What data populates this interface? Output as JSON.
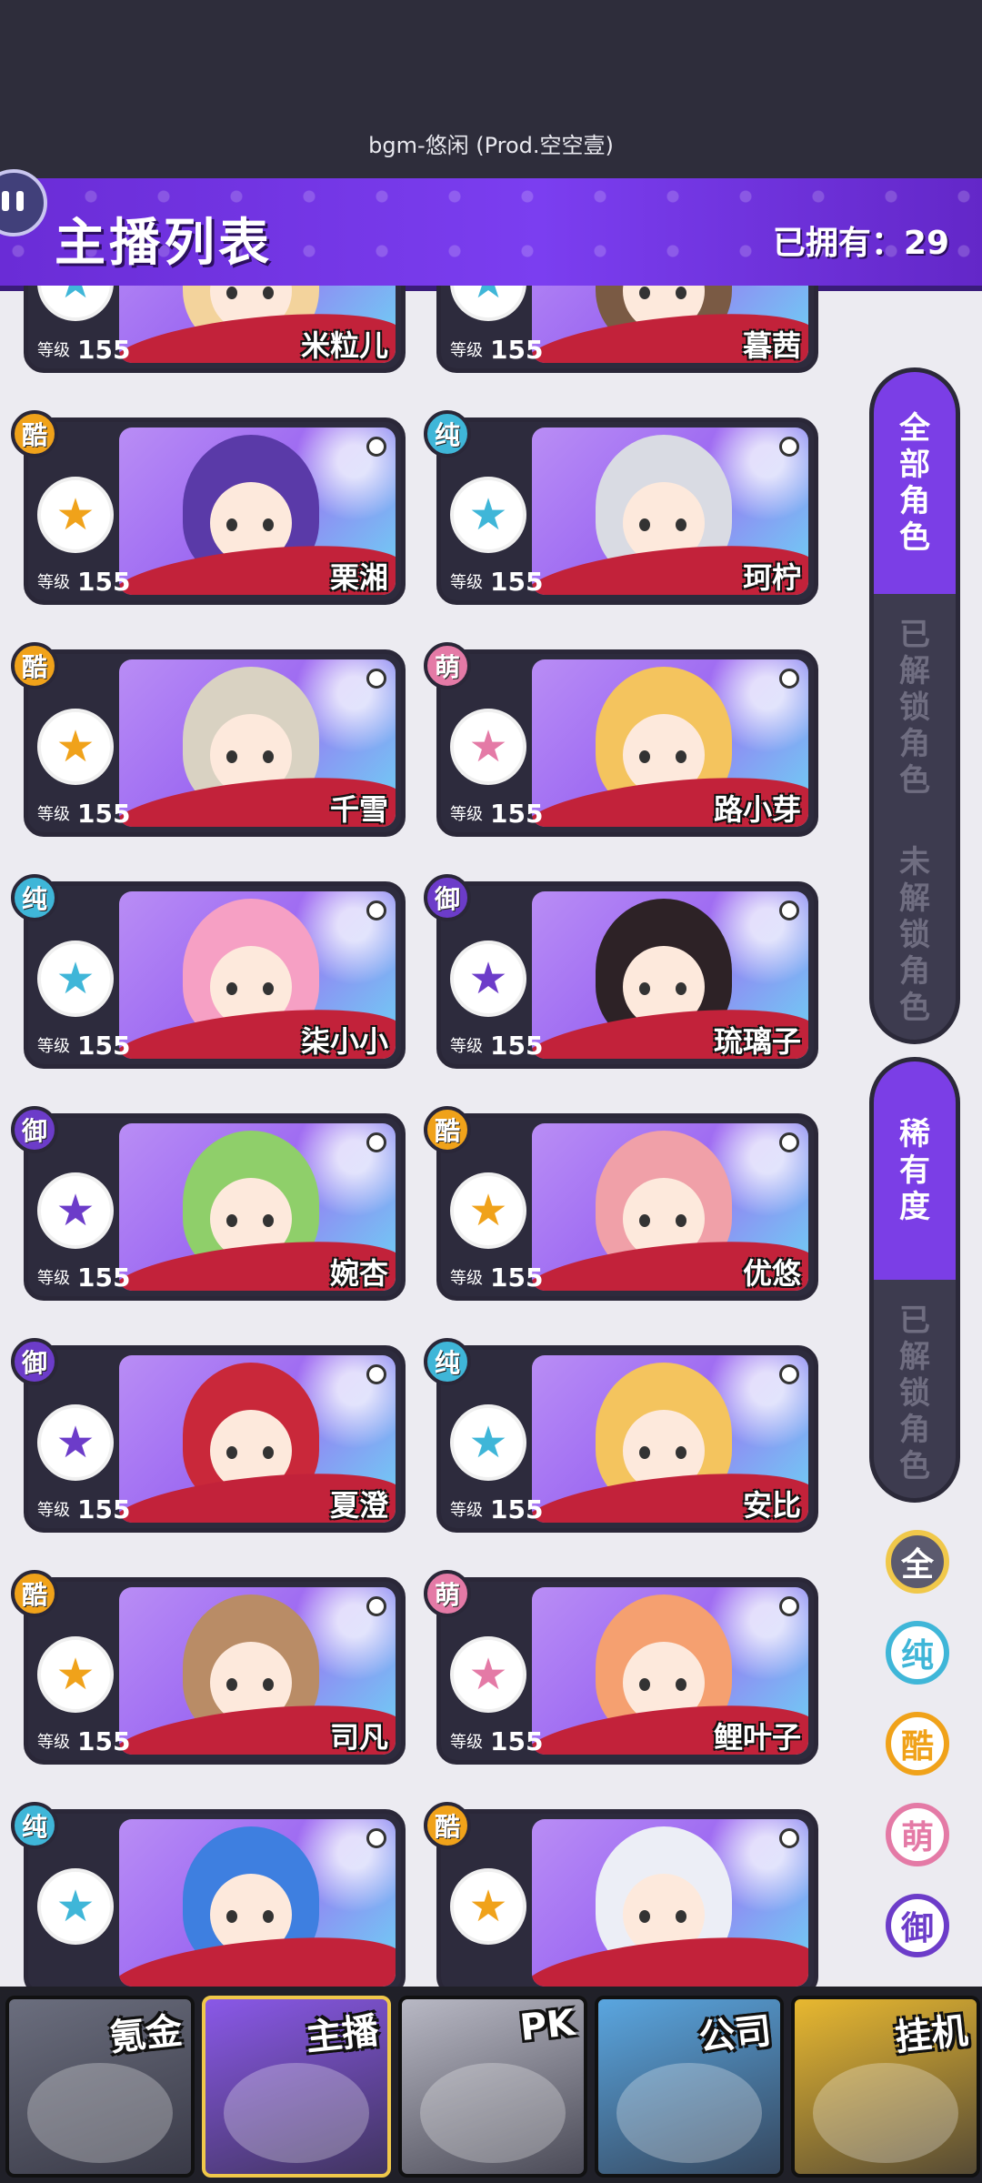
{
  "bgm": "bgm-悠闲 (Prod.空空壹)",
  "header": {
    "title": "主播列表",
    "owned": "已拥有：29"
  },
  "level_label": "等级",
  "attributes": {
    "纯": "#3fb6d8",
    "酷": "#f0a21a",
    "萌": "#e47aa6",
    "御": "#6c3cc9"
  },
  "hair_colors": {
    "blonde": "#f3d39c",
    "brown": "#7a5a44",
    "purple": "#5a3aa8",
    "silver": "#d9dbe3",
    "ash": "#d9d2c2",
    "gold": "#f4c45e",
    "pink": "#f6a0c4",
    "black": "#2d2226",
    "green": "#8fcf6a",
    "rose": "#f0a0a8",
    "red": "#c9283a",
    "tan": "#b98c66",
    "orange": "#f5a070",
    "blue": "#3e7fe0",
    "white": "#eceef6"
  },
  "characters": [
    {
      "name": "米粒儿",
      "level": "155",
      "attr": "",
      "hair": "blonde"
    },
    {
      "name": "暮茜",
      "level": "155",
      "attr": "",
      "hair": "brown"
    },
    {
      "name": "栗湘",
      "level": "155",
      "attr": "酷",
      "hair": "purple"
    },
    {
      "name": "珂柠",
      "level": "155",
      "attr": "纯",
      "hair": "silver"
    },
    {
      "name": "千雪",
      "level": "155",
      "attr": "酷",
      "hair": "ash"
    },
    {
      "name": "路小芽",
      "level": "155",
      "attr": "萌",
      "hair": "gold"
    },
    {
      "name": "柒小小",
      "level": "155",
      "attr": "纯",
      "hair": "pink"
    },
    {
      "name": "琉璃子",
      "level": "155",
      "attr": "御",
      "hair": "black"
    },
    {
      "name": "婉杏",
      "level": "155",
      "attr": "御",
      "hair": "green"
    },
    {
      "name": "优悠",
      "level": "155",
      "attr": "酷",
      "hair": "rose"
    },
    {
      "name": "夏澄",
      "level": "155",
      "attr": "御",
      "hair": "red"
    },
    {
      "name": "安比",
      "level": "155",
      "attr": "纯",
      "hair": "gold"
    },
    {
      "name": "司凡",
      "level": "155",
      "attr": "酷",
      "hair": "tan"
    },
    {
      "name": "鲤叶子",
      "level": "155",
      "attr": "萌",
      "hair": "orange"
    },
    {
      "name": "",
      "level": "",
      "attr": "纯",
      "hair": "blue"
    },
    {
      "name": "",
      "level": "",
      "attr": "酷",
      "hair": "white"
    }
  ],
  "sidebar": {
    "role_filter": [
      "全部角色",
      "已解锁角色",
      "未解锁角色"
    ],
    "rarity_filter": [
      "稀有度",
      "已解锁角色"
    ],
    "attribute_filters": [
      {
        "label": "全",
        "color": "#5b5a6e"
      },
      {
        "label": "纯",
        "color": "#3fb6d8"
      },
      {
        "label": "酷",
        "color": "#f0a21a"
      },
      {
        "label": "萌",
        "color": "#e47aa6"
      },
      {
        "label": "御",
        "color": "#6c3cc9"
      }
    ]
  },
  "bottom_nav": [
    {
      "label": "氪金",
      "color": "#6b6e7e"
    },
    {
      "label": "主播",
      "color": "#8a58e8"
    },
    {
      "label": "PK",
      "color": "#b8b8c4"
    },
    {
      "label": "公司",
      "color": "#5aa6e0"
    },
    {
      "label": "挂机",
      "color": "#e8b830"
    }
  ]
}
